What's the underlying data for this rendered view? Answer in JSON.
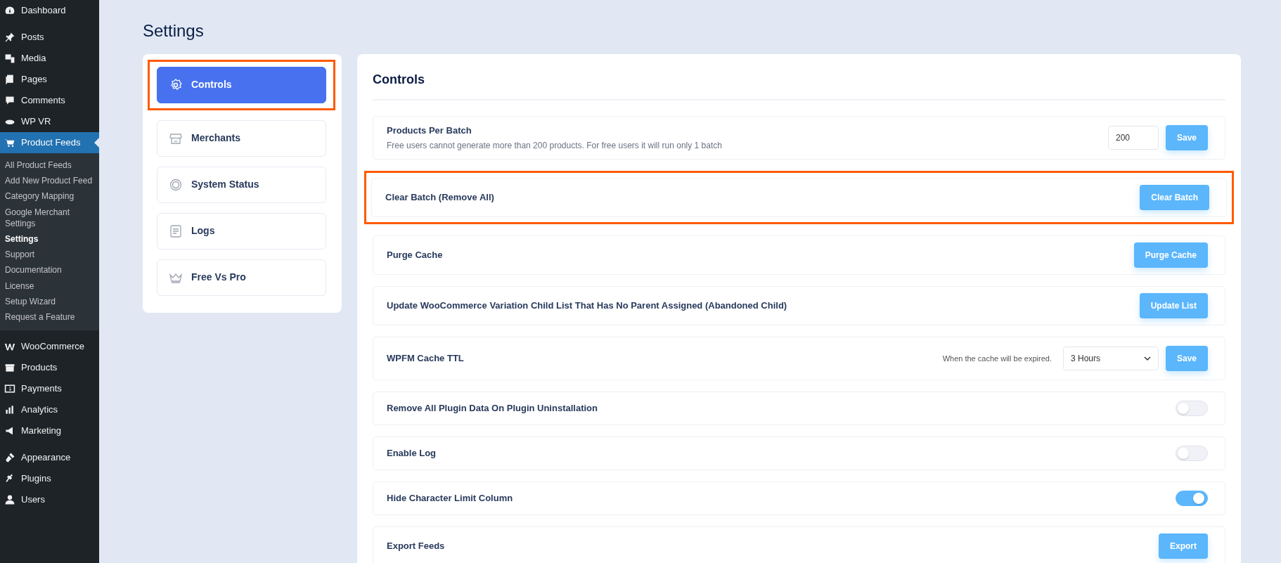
{
  "sidebar": {
    "items": [
      {
        "label": "Dashboard",
        "selected": false
      },
      {
        "label": "Posts",
        "selected": false
      },
      {
        "label": "Media",
        "selected": false
      },
      {
        "label": "Pages",
        "selected": false
      },
      {
        "label": "Comments",
        "selected": false
      },
      {
        "label": "WP VR",
        "selected": false
      },
      {
        "label": "Product Feeds",
        "selected": true,
        "expanded": true,
        "children": [
          {
            "label": "All Product Feeds",
            "selected": false
          },
          {
            "label": "Add New Product Feed",
            "selected": false
          },
          {
            "label": "Category Mapping",
            "selected": false
          },
          {
            "label": "Google Merchant Settings",
            "selected": false
          },
          {
            "label": "Settings",
            "selected": true
          },
          {
            "label": "Support",
            "selected": false
          },
          {
            "label": "Documentation",
            "selected": false
          },
          {
            "label": "License",
            "selected": false
          },
          {
            "label": "Setup Wizard",
            "selected": false
          },
          {
            "label": "Request a Feature",
            "selected": false
          }
        ]
      },
      {
        "label": "WooCommerce",
        "selected": false
      },
      {
        "label": "Products",
        "selected": false
      },
      {
        "label": "Payments",
        "selected": false
      },
      {
        "label": "Analytics",
        "selected": false
      },
      {
        "label": "Marketing",
        "selected": false
      },
      {
        "label": "Appearance",
        "selected": false
      },
      {
        "label": "Plugins",
        "selected": false
      },
      {
        "label": "Users",
        "selected": false
      }
    ]
  },
  "page_title": "Settings",
  "settings_menu": [
    {
      "label": "Controls",
      "selected": true,
      "highlighted": true
    },
    {
      "label": "Merchants",
      "selected": false,
      "highlighted": false
    },
    {
      "label": "System Status",
      "selected": false,
      "highlighted": false
    },
    {
      "label": "Logs",
      "selected": false,
      "highlighted": false
    },
    {
      "label": "Free Vs Pro",
      "selected": false,
      "highlighted": false
    }
  ],
  "panel": {
    "title": "Controls",
    "rows": [
      {
        "kind": "input",
        "label": "Products Per Batch",
        "description": "Free users cannot generate more than 200 products. For free users it will run only 1 batch",
        "value": "200",
        "button": "Save",
        "highlighted": false
      },
      {
        "kind": "button",
        "label": "Clear Batch (Remove All)",
        "button": "Clear Batch",
        "highlighted": true
      },
      {
        "kind": "button",
        "label": "Purge Cache",
        "button": "Purge Cache",
        "highlighted": false
      },
      {
        "kind": "button",
        "label": "Update WooCommerce Variation Child List That Has No Parent Assigned (Abandoned Child)",
        "button": "Update List",
        "highlighted": false
      },
      {
        "kind": "select",
        "label": "WPFM Cache TTL",
        "hint": "When the cache will be expired.",
        "value": "3 Hours",
        "button": "Save",
        "highlighted": false
      },
      {
        "kind": "toggle",
        "label": "Remove All Plugin Data On Plugin Uninstallation",
        "checked": false,
        "highlighted": false
      },
      {
        "kind": "toggle",
        "label": "Enable Log",
        "checked": false,
        "highlighted": false
      },
      {
        "kind": "toggle",
        "label": "Hide Character Limit Column",
        "checked": true,
        "highlighted": false
      },
      {
        "kind": "button",
        "label": "Export Feeds",
        "button": "Export",
        "highlighted": false
      }
    ]
  }
}
